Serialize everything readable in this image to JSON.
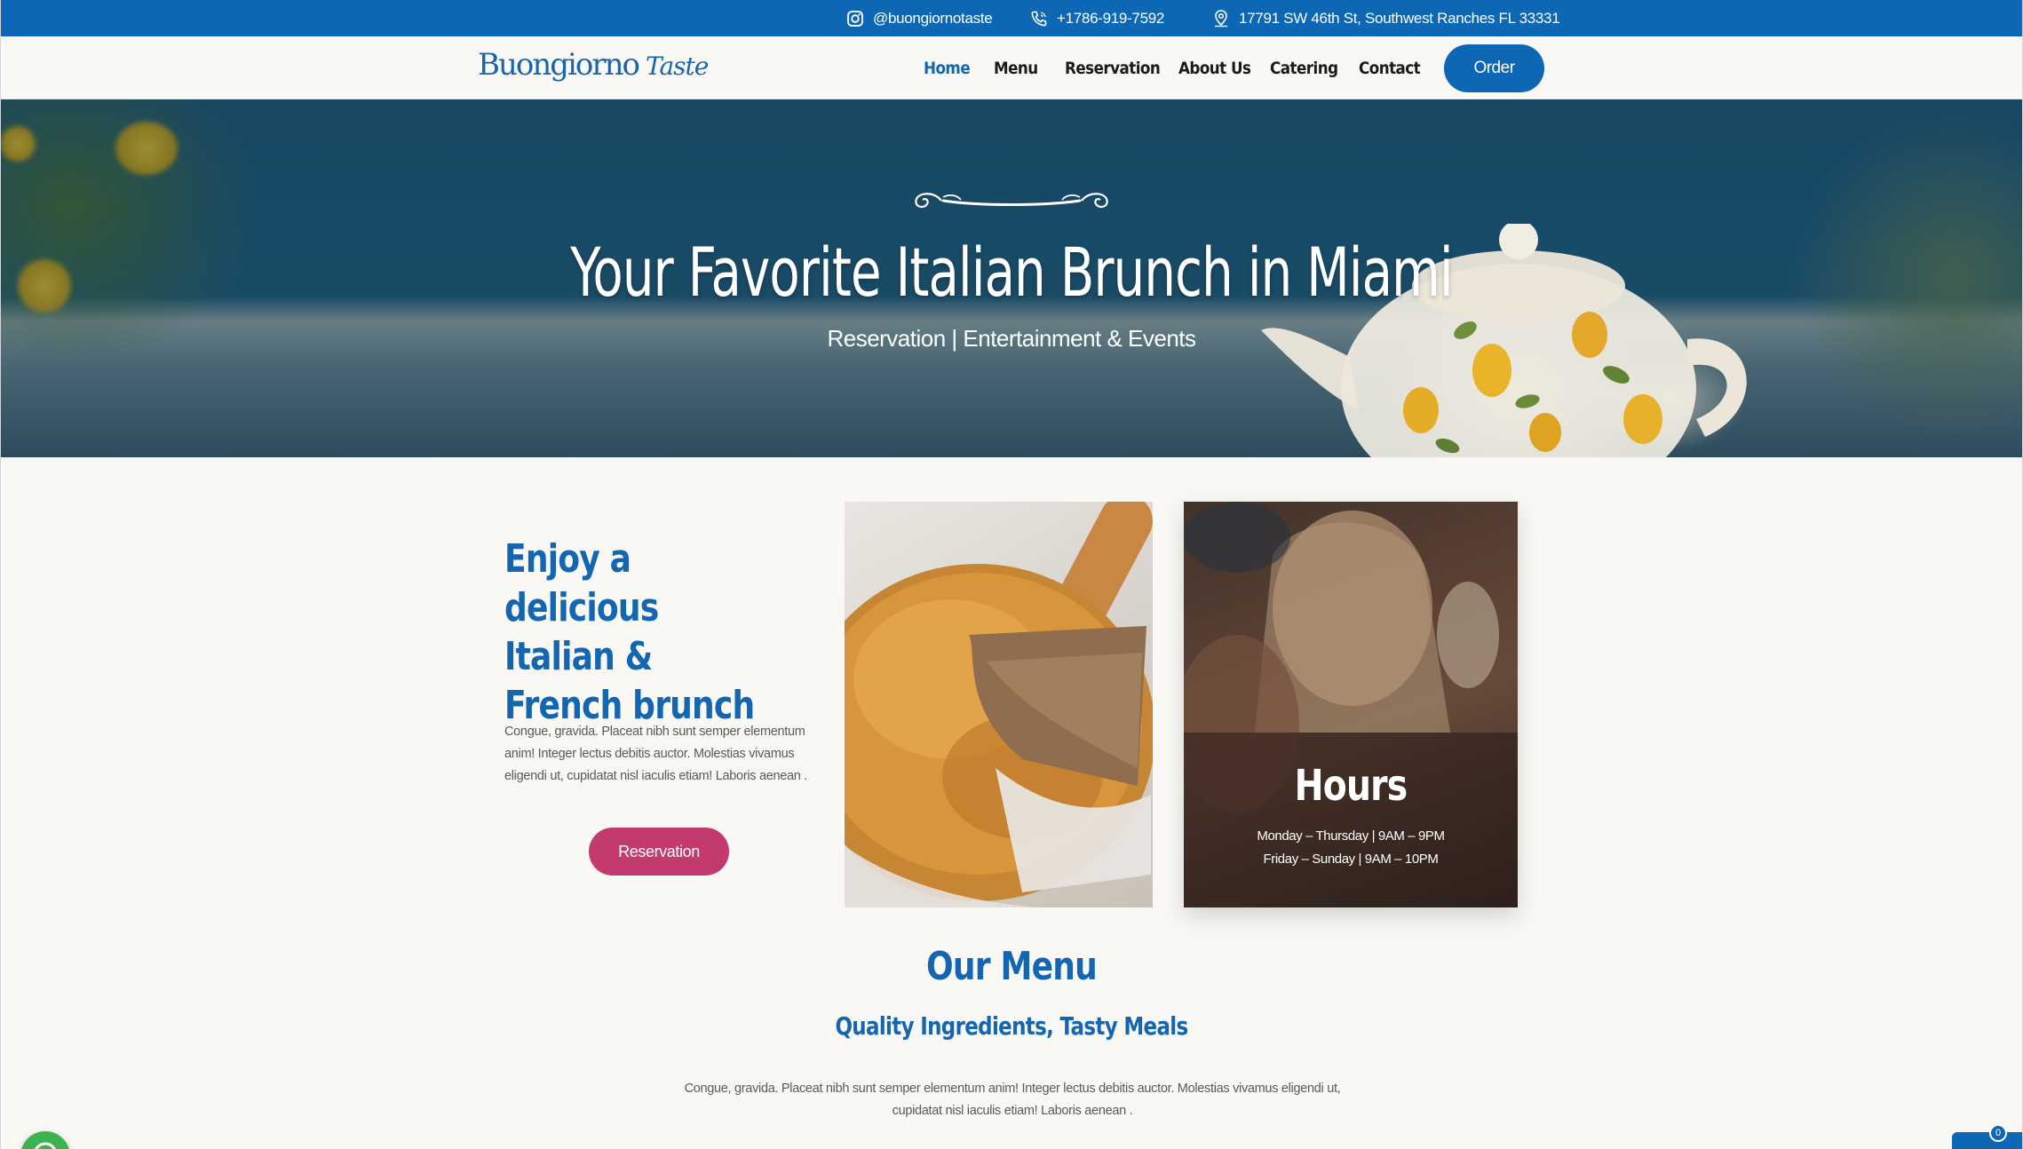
{
  "topbar": {
    "instagram": "@buongiornotaste",
    "phone": "+1786-919-7592",
    "address": "17791 SW 46th St, Southwest Ranches FL 33331"
  },
  "header": {
    "logo_main": "Buongiorno",
    "logo_sub": "Taste",
    "nav": [
      "Home",
      "Menu",
      "Reservation",
      "About Us",
      "Catering",
      "Contact"
    ],
    "active_nav": "Home",
    "order_label": "Order"
  },
  "hero": {
    "title": "Your Favorite Italian Brunch in Miami",
    "subtitle": "Reservation | Entertainment & Events"
  },
  "intro": {
    "title": "Enjoy a delicious Italian & French brunch",
    "text": "Congue, gravida. Placeat nibh sunt semper elementum anim! Integer lectus debitis auctor. Molestias vivamus eligendi ut, cupidatat nisl iaculis etiam! Laboris aenean .",
    "button": "Reservation"
  },
  "hours": {
    "title": "Hours",
    "line1": "Monday – Thursday | 9AM – 9PM",
    "line2": "Friday – Sunday | 9AM – 10PM"
  },
  "menu_section": {
    "title": "Our Menu",
    "subtitle": "Quality Ingredients, Tasty Meals",
    "text": "Congue, gravida. Placeat nibh sunt semper elementum anim! Integer lectus debitis auctor. Molestias vivamus eligendi ut, cupidatat nisl iaculis etiam! Laboris aenean ."
  },
  "chat": {
    "badge": "0"
  },
  "colors": {
    "brand_blue": "#0d67b5",
    "accent_pink": "#c23a6e",
    "background": "#f9f8f4"
  },
  "icons": [
    "instagram-icon",
    "phone-icon",
    "location-pin-icon",
    "flourish-divider-icon",
    "whatsapp-icon",
    "chat-icon"
  ]
}
